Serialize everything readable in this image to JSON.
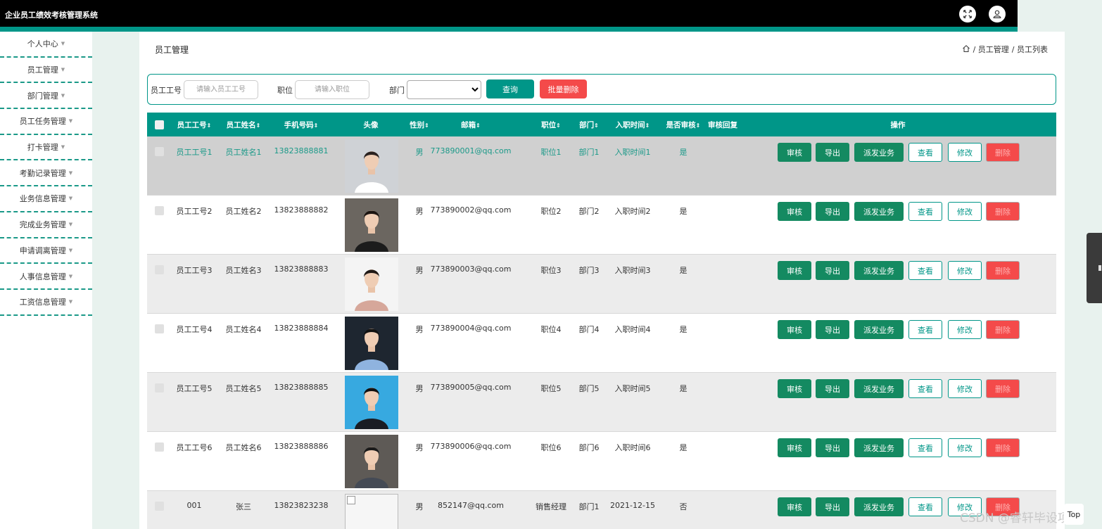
{
  "app": {
    "title": "企业员工绩效考核管理系统"
  },
  "top_icons": {
    "fullscreen": "expand-icon",
    "user": "user-icon"
  },
  "sidebar": {
    "items": [
      {
        "label": "个人中心"
      },
      {
        "label": "员工管理"
      },
      {
        "label": "部门管理"
      },
      {
        "label": "员工任务管理"
      },
      {
        "label": "打卡管理"
      },
      {
        "label": "考勤记录管理"
      },
      {
        "label": "业务信息管理"
      },
      {
        "label": "完成业务管理"
      },
      {
        "label": "申请调离管理"
      },
      {
        "label": "人事信息管理"
      },
      {
        "label": "工资信息管理"
      }
    ]
  },
  "header": {
    "title": "员工管理",
    "breadcrumb": {
      "home_icon": "home-icon",
      "level1": "/ 员工管理",
      "level2": "/ 员工列表"
    }
  },
  "search": {
    "employee_id_label": "员工工号",
    "employee_id_placeholder": "请输入员工工号",
    "position_label": "职位",
    "position_placeholder": "请输入职位",
    "department_label": "部门",
    "department_value": "",
    "query_button": "查询",
    "batch_delete_button": "批量删除"
  },
  "table": {
    "columns": [
      "员工工号",
      "员工姓名",
      "手机号码",
      "头像",
      "性别",
      "邮箱",
      "职位",
      "部门",
      "入职时间",
      "是否审核",
      "审核回复",
      "操作"
    ],
    "sort_symbol": "⇕",
    "actions": [
      "审核",
      "导出",
      "派发业务",
      "查看",
      "修改",
      "删除"
    ],
    "rows": [
      {
        "id": "员工工号1",
        "name": "员工姓名1",
        "phone": "13823888881",
        "gender": "男",
        "email": "773890001@qq.com",
        "position": "职位1",
        "dept": "部门1",
        "hire": "入职时间1",
        "approved": "是",
        "reply": ""
      },
      {
        "id": "员工工号2",
        "name": "员工姓名2",
        "phone": "13823888882",
        "gender": "男",
        "email": "773890002@qq.com",
        "position": "职位2",
        "dept": "部门2",
        "hire": "入职时间2",
        "approved": "是",
        "reply": ""
      },
      {
        "id": "员工工号3",
        "name": "员工姓名3",
        "phone": "13823888883",
        "gender": "男",
        "email": "773890003@qq.com",
        "position": "职位3",
        "dept": "部门3",
        "hire": "入职时间3",
        "approved": "是",
        "reply": ""
      },
      {
        "id": "员工工号4",
        "name": "员工姓名4",
        "phone": "13823888884",
        "gender": "男",
        "email": "773890004@qq.com",
        "position": "职位4",
        "dept": "部门4",
        "hire": "入职时间4",
        "approved": "是",
        "reply": ""
      },
      {
        "id": "员工工号5",
        "name": "员工姓名5",
        "phone": "13823888885",
        "gender": "男",
        "email": "773890005@qq.com",
        "position": "职位5",
        "dept": "部门5",
        "hire": "入职时间5",
        "approved": "是",
        "reply": ""
      },
      {
        "id": "员工工号6",
        "name": "员工姓名6",
        "phone": "13823888886",
        "gender": "男",
        "email": "773890006@qq.com",
        "position": "职位6",
        "dept": "部门6",
        "hire": "入职时间6",
        "approved": "是",
        "reply": ""
      },
      {
        "id": "001",
        "name": "张三",
        "phone": "13823823238",
        "gender": "男",
        "email": "852147@qq.com",
        "position": "销售经理",
        "dept": "部门1",
        "hire": "2021-12-15",
        "approved": "否",
        "reply": ""
      }
    ]
  },
  "watermark": "CSDN @睿轩毕设项目",
  "top_button": "Top",
  "colors": {
    "primary": "#009688",
    "danger": "#f44a4a",
    "action_fill": "#148a61",
    "topbar": "#000000"
  }
}
